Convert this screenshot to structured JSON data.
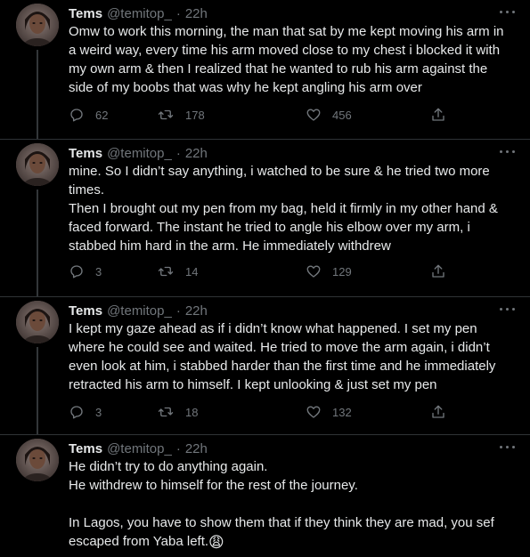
{
  "tweets": [
    {
      "name": "Tems",
      "handle": "@temitop_",
      "separator": "·",
      "time": "22h",
      "text": "Omw to work this morning, the man that sat by me kept moving his arm in a weird way, every time his arm moved close to my chest i blocked it with my own arm & then I realized that he wanted to rub his arm against the side of my boobs that was why he kept angling his arm over",
      "replies": "62",
      "retweets": "178",
      "likes": "456"
    },
    {
      "name": "Tems",
      "handle": "@temitop_",
      "separator": "·",
      "time": "22h",
      "text": "mine. So I didn’t say anything, i watched to be sure & he tried two more times.\nThen I brought out my pen from my bag, held it firmly in my other hand & faced forward. The instant he tried to angle his elbow over my arm, i stabbed him hard in the arm. He immediately withdrew",
      "replies": "3",
      "retweets": "14",
      "likes": "129"
    },
    {
      "name": "Tems",
      "handle": "@temitop_",
      "separator": "·",
      "time": "22h",
      "text": "I kept my gaze ahead as if i didn’t know what happened. I set my pen where he could see and waited. He tried to move the arm again, i didn’t even look at him, i stabbed harder than the first time and he immediately retracted his arm to himself. I kept unlooking & just set my pen",
      "replies": "3",
      "retweets": "18",
      "likes": "132"
    },
    {
      "name": "Tems",
      "handle": "@temitop_",
      "separator": "·",
      "time": "22h",
      "text": "He didn’t try to do anything again.\nHe withdrew to himself for the rest of the journey.\n\nIn Lagos, you have to show them that if they think they are mad, you sef escaped from Yaba left.",
      "emoji": "😩"
    }
  ],
  "colors": {
    "background": "#000000",
    "primary_text": "#e7e9ea",
    "secondary_text": "#71767b",
    "divider": "#2f3336"
  },
  "icons": [
    "avatar-photo",
    "more-icon",
    "reply-icon",
    "retweet-icon",
    "like-icon",
    "share-icon"
  ]
}
